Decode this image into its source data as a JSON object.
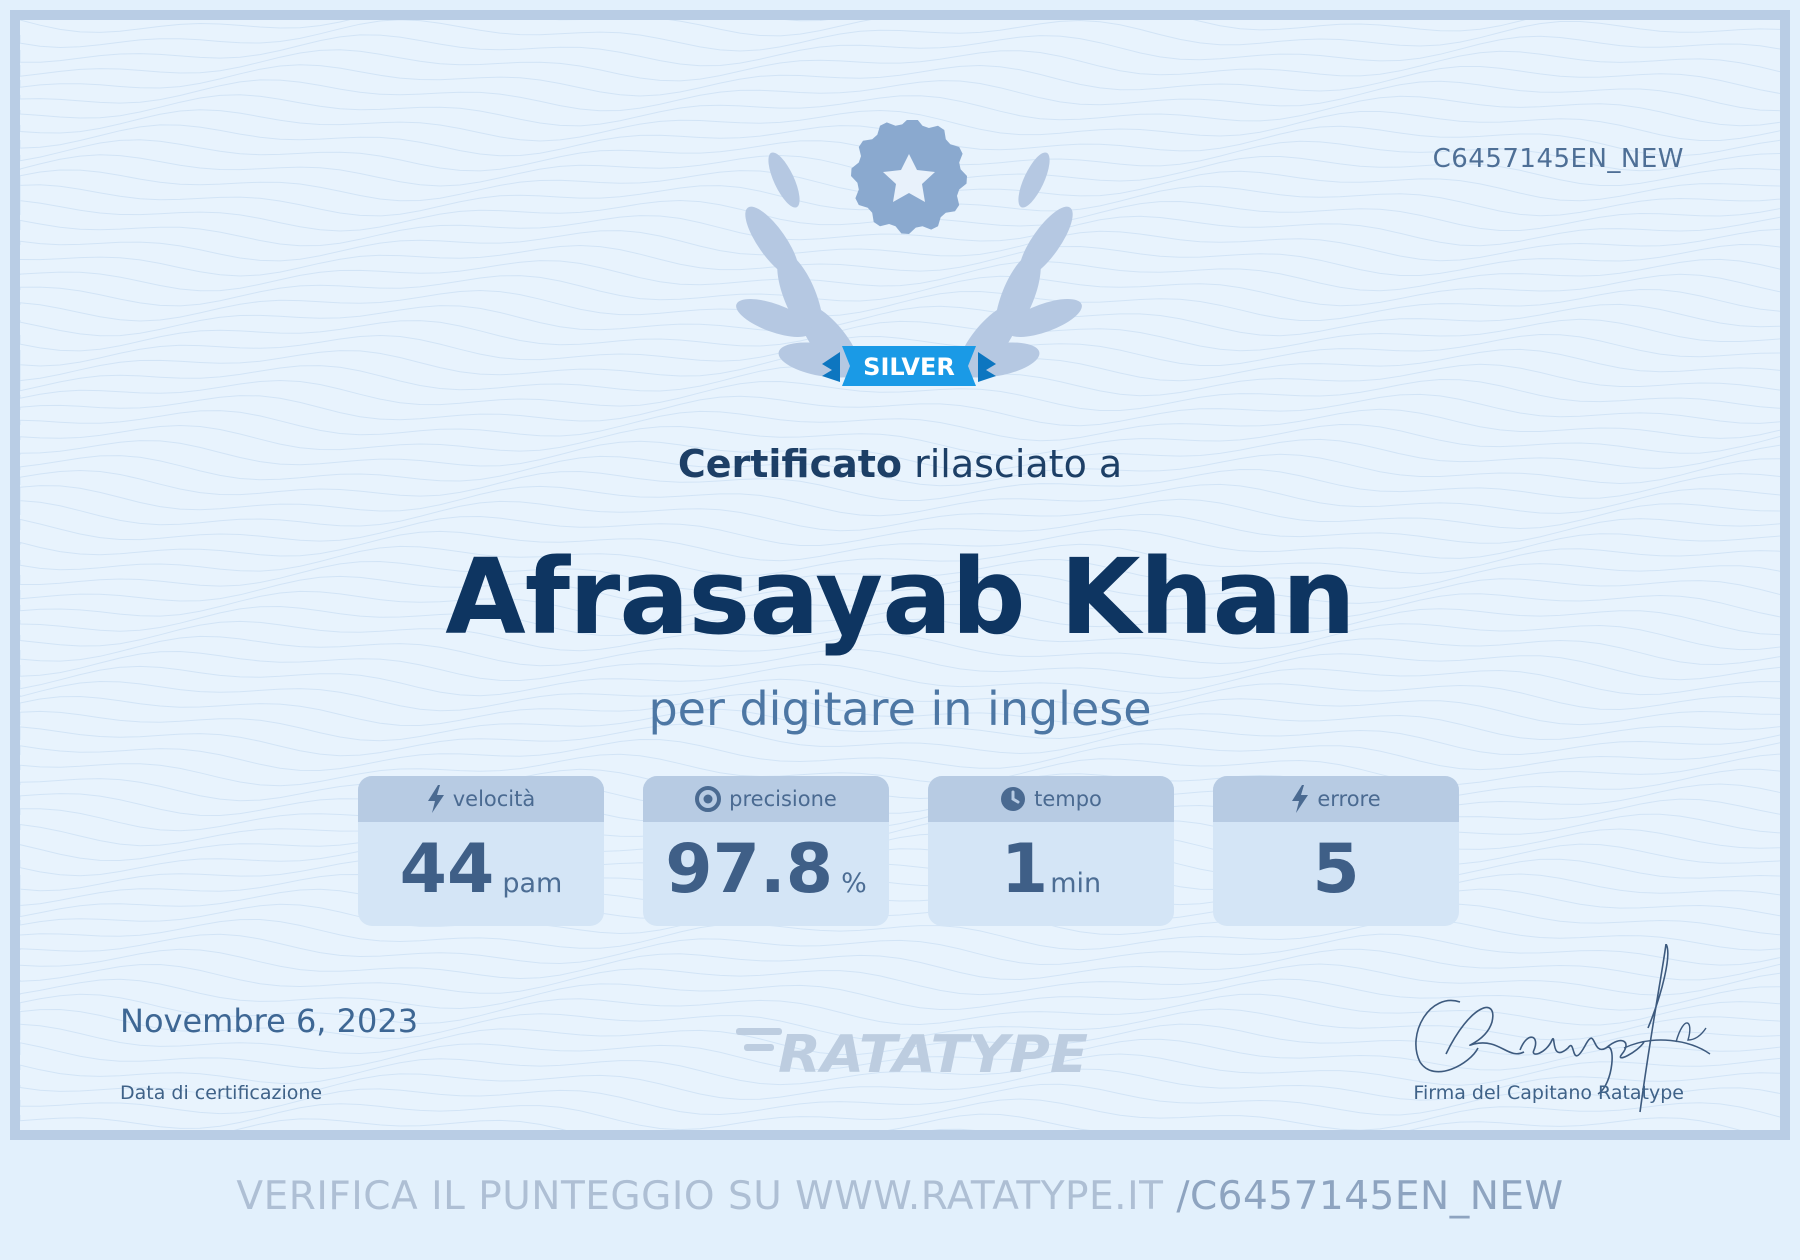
{
  "certificate": {
    "code": "C6457145EN_NEW",
    "level_badge": "SILVER",
    "heading_strong": "Certificato",
    "heading_rest": "rilasciato a",
    "recipient_name": "Afrasayab Khan",
    "subject": "per digitare in inglese"
  },
  "stats": [
    {
      "label": "velocità",
      "value": "44",
      "unit": "pam",
      "icon": "lightning-icon"
    },
    {
      "label": "precisione",
      "value": "97.8",
      "unit": "%",
      "icon": "target-icon"
    },
    {
      "label": "tempo",
      "value": "1",
      "unit": "min",
      "icon": "clock-icon"
    },
    {
      "label": "errore",
      "value": "5",
      "unit": "",
      "icon": "lightning-icon"
    }
  ],
  "footer": {
    "date": "Novembre 6, 2023",
    "date_label": "Data di certificazione",
    "logo_text": "RATATYPE",
    "signature_label": "Firma del Capitano Ratatype",
    "verify_text": "VERIFICA IL PUNTEGGIO SU WWW.RATATYPE.IT ",
    "verify_code": "/C6457145EN_NEW"
  },
  "colors": {
    "background": "#e8f3fd",
    "border": "#b9cde5",
    "name": "#0e3561",
    "badge_ribbon": "#1a9ae6"
  }
}
